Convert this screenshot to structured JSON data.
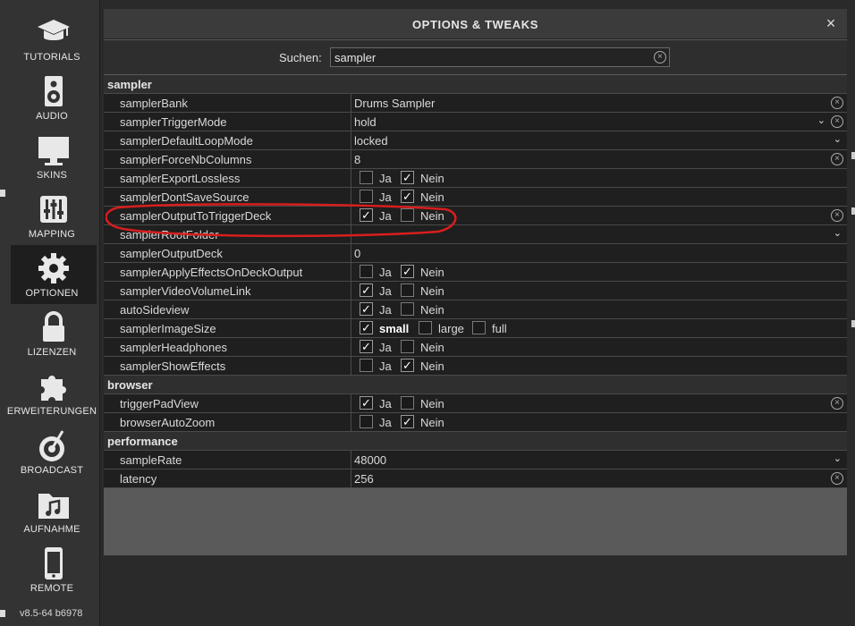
{
  "sidebar": {
    "items": [
      {
        "label": "TUTORIALS",
        "icon": "graduation-cap-icon"
      },
      {
        "label": "AUDIO",
        "icon": "speaker-icon"
      },
      {
        "label": "SKINS",
        "icon": "monitor-icon"
      },
      {
        "label": "MAPPING",
        "icon": "sliders-icon"
      },
      {
        "label": "OPTIONEN",
        "icon": "gear-icon"
      },
      {
        "label": "LIZENZEN",
        "icon": "lock-icon"
      },
      {
        "label": "ERWEITERUNGEN",
        "icon": "puzzle-icon"
      },
      {
        "label": "BROADCAST",
        "icon": "broadcast-icon"
      },
      {
        "label": "AUFNAHME",
        "icon": "music-folder-icon"
      },
      {
        "label": "REMOTE",
        "icon": "phone-icon"
      }
    ],
    "active": "OPTIONEN",
    "version": "v8.5-64 b6978"
  },
  "dialog": {
    "title": "OPTIONS & TWEAKS",
    "close": "×"
  },
  "search": {
    "label": "Suchen:",
    "value": "sampler"
  },
  "sections": [
    {
      "title": "sampler",
      "rows": [
        {
          "name": "samplerBank",
          "value": "Drums Sampler",
          "clear": true
        },
        {
          "name": "samplerTriggerMode",
          "value": "hold",
          "dropdown": true,
          "clear": true
        },
        {
          "name": "samplerDefaultLoopMode",
          "value": "locked",
          "dropdown": true
        },
        {
          "name": "samplerForceNbColumns",
          "value": "8",
          "clear": true
        },
        {
          "name": "samplerExportLossless",
          "options": [
            {
              "label": "Ja",
              "checked": false
            },
            {
              "label": "Nein",
              "checked": true
            }
          ]
        },
        {
          "name": "samplerDontSaveSource",
          "options": [
            {
              "label": "Ja",
              "checked": false
            },
            {
              "label": "Nein",
              "checked": true
            }
          ]
        },
        {
          "name": "samplerOutputToTriggerDeck",
          "options": [
            {
              "label": "Ja",
              "checked": true
            },
            {
              "label": "Nein",
              "checked": false
            }
          ],
          "clear": true
        },
        {
          "name": "samplerRootFolder",
          "value": "",
          "dropdown": true
        },
        {
          "name": "samplerOutputDeck",
          "value": "0"
        },
        {
          "name": "samplerApplyEffectsOnDeckOutput",
          "options": [
            {
              "label": "Ja",
              "checked": false
            },
            {
              "label": "Nein",
              "checked": true
            }
          ]
        },
        {
          "name": "samplerVideoVolumeLink",
          "options": [
            {
              "label": "Ja",
              "checked": true
            },
            {
              "label": "Nein",
              "checked": false
            }
          ]
        },
        {
          "name": "autoSideview",
          "options": [
            {
              "label": "Ja",
              "checked": true
            },
            {
              "label": "Nein",
              "checked": false
            }
          ]
        },
        {
          "name": "samplerImageSize",
          "options": [
            {
              "label": "small",
              "checked": true,
              "bold": true
            },
            {
              "label": "large",
              "checked": false
            },
            {
              "label": "full",
              "checked": false
            }
          ]
        },
        {
          "name": "samplerHeadphones",
          "options": [
            {
              "label": "Ja",
              "checked": true
            },
            {
              "label": "Nein",
              "checked": false
            }
          ]
        },
        {
          "name": "samplerShowEffects",
          "options": [
            {
              "label": "Ja",
              "checked": false
            },
            {
              "label": "Nein",
              "checked": true
            }
          ]
        }
      ]
    },
    {
      "title": "browser",
      "rows": [
        {
          "name": "triggerPadView",
          "options": [
            {
              "label": "Ja",
              "checked": true
            },
            {
              "label": "Nein",
              "checked": false
            }
          ],
          "clear": true
        },
        {
          "name": "browserAutoZoom",
          "options": [
            {
              "label": "Ja",
              "checked": false
            },
            {
              "label": "Nein",
              "checked": true
            }
          ]
        }
      ]
    },
    {
      "title": "performance",
      "rows": [
        {
          "name": "sampleRate",
          "value": "48000",
          "dropdown": true
        },
        {
          "name": "latency",
          "value": "256",
          "clear": true
        }
      ]
    }
  ],
  "glyphs": {
    "check": "✓",
    "chevron": "⌄",
    "clear": "×"
  },
  "colors": {
    "highlight_ellipse": "#d81e1e",
    "row_bg": "#1f1f1f",
    "section_bg": "#2f2f2f"
  }
}
